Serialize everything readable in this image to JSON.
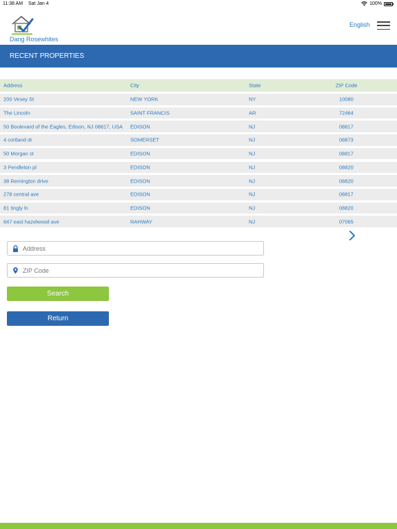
{
  "status_bar": {
    "time": "11:38 AM",
    "date": "Sat Jan 4",
    "battery": "100%",
    "icons": [
      "wifi-icon",
      "battery-icon"
    ]
  },
  "header": {
    "logo_text": "PROPERTY RENOVATION",
    "brand_name": "Dang Rosewhites",
    "language": "English",
    "menu_icon": "hamburger-menu-icon"
  },
  "banner": {
    "title": "RECENT PROPERTIES"
  },
  "table": {
    "columns": [
      "Address",
      "City",
      "State",
      "ZIP Code"
    ],
    "rows": [
      [
        "200 Vesey St",
        "NEW YORK",
        "NY",
        "10080"
      ],
      [
        "The Lincoln",
        "SAINT FRANCIS",
        "AR",
        "72464"
      ],
      [
        "50 Boulevard of the Eagles, Edison, NJ 08817, USA",
        "EDISON",
        "NJ",
        "08817"
      ],
      [
        "4 cortland dr",
        "SOMERSET",
        "NJ",
        "08873"
      ],
      [
        "50 Morgan st",
        "EDISON",
        "NJ",
        "08817"
      ],
      [
        "3 Pendleton pl",
        "EDISON",
        "NJ",
        "08820"
      ],
      [
        "38 Remington drive",
        "EDISON",
        "NJ",
        "08820"
      ],
      [
        "278 central ave",
        "EDISON",
        "NJ",
        "08817"
      ],
      [
        "81 tingly ln",
        "EDISON",
        "NJ",
        "08820"
      ],
      [
        "847 east hazelwood ave",
        "RAHWAY",
        "NJ",
        "07065"
      ]
    ],
    "next_icon": "chevron-right-icon"
  },
  "search": {
    "address_placeholder": "Address",
    "address_value": "",
    "zip_placeholder": "ZIP Code",
    "zip_value": "",
    "address_icon": "lock-icon",
    "zip_icon": "location-pin-icon",
    "search_label": "Search",
    "return_label": "Return"
  },
  "colors": {
    "primary_blue": "#2d69b0",
    "accent_green": "#8dc63f",
    "link_blue": "#2b7bc0",
    "header_row": "#e1ecd6",
    "row_bg": "#ececec"
  }
}
